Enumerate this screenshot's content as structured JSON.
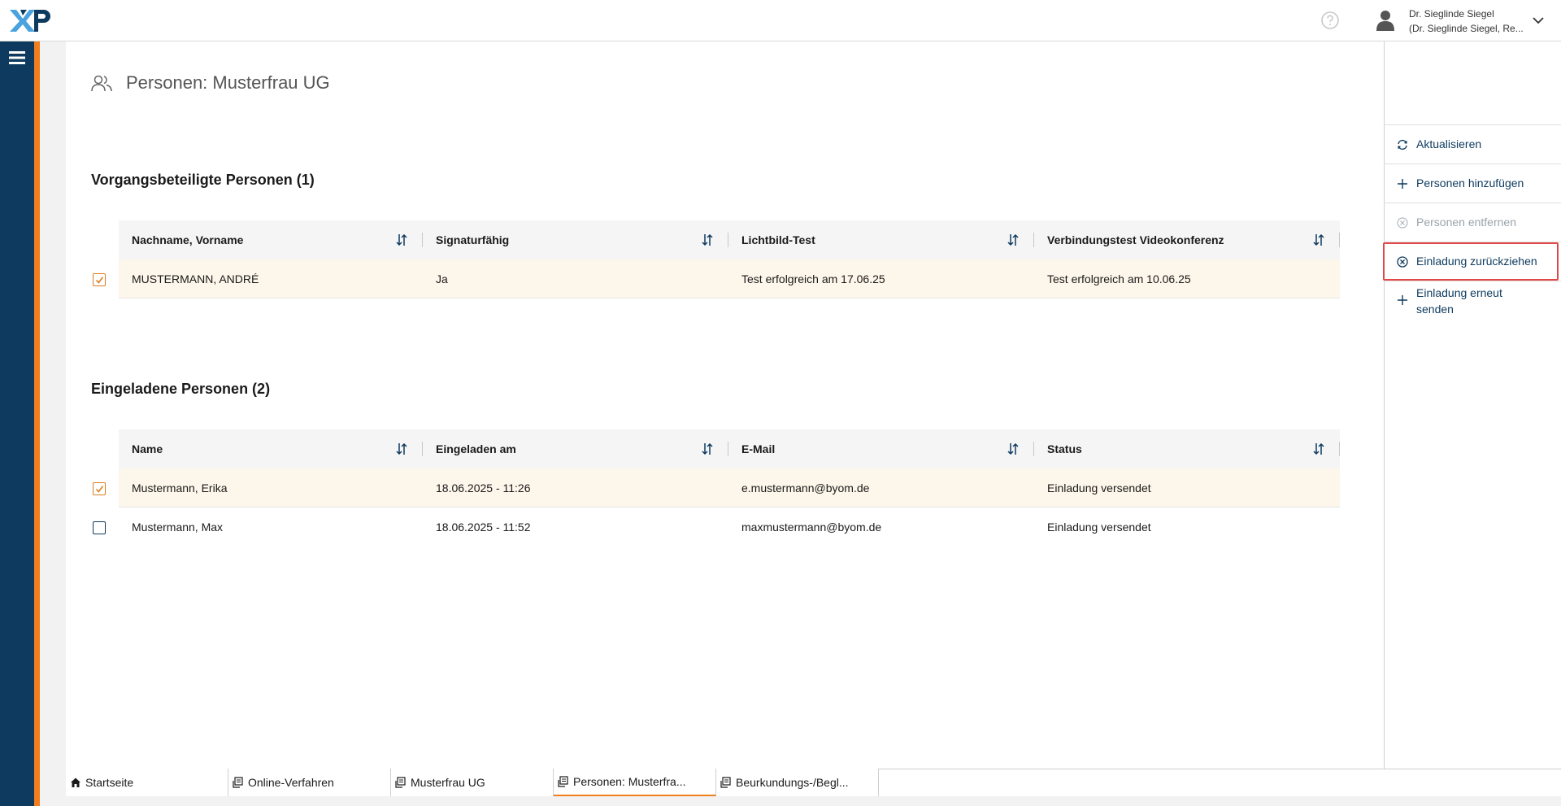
{
  "header": {
    "logo_text": "XNP",
    "help_icon": "question-circle-icon",
    "user": {
      "name": "Dr. Sieglinde Siegel",
      "role": "(Dr. Sieglinde Siegel, Re..."
    }
  },
  "colors": {
    "rail": "#0d3a5e",
    "accent": "#f07e1f",
    "link": "#0d3a5e",
    "highlight": "#e04848",
    "selected_row": "#fdf6ea"
  },
  "page": {
    "title": "Personen: Musterfrau UG"
  },
  "section1": {
    "title": "Vorgangsbeteiligte Personen (1)",
    "columns": [
      "Nachname, Vorname",
      "Signaturfähig",
      "Lichtbild-Test",
      "Verbindungstest Videokonferenz"
    ],
    "rows": [
      {
        "checked": true,
        "cells": [
          "MUSTERMANN, ANDRÉ",
          "Ja",
          "Test erfolgreich am 17.06.25",
          "Test erfolgreich am 10.06.25"
        ]
      }
    ]
  },
  "section2": {
    "title": "Eingeladene Personen (2)",
    "columns": [
      "Name",
      "Eingeladen am",
      "E-Mail",
      "Status"
    ],
    "rows": [
      {
        "checked": true,
        "cells": [
          "Mustermann, Erika",
          "18.06.2025 - 11:26",
          "e.mustermann@byom.de",
          "Einladung versendet"
        ]
      },
      {
        "checked": false,
        "cells": [
          "Mustermann, Max",
          "18.06.2025 - 11:52",
          "maxmustermann@byom.de",
          "Einladung versendet"
        ]
      }
    ]
  },
  "actions": {
    "refresh": "Aktualisieren",
    "add": "Personen hinzufügen",
    "remove": "Personen entfernen",
    "withdraw": "Einladung zurückziehen",
    "resend_line1": "Einladung erneut",
    "resend_line2": "senden"
  },
  "tabs": [
    {
      "label": "Startseite",
      "icon": "home-icon"
    },
    {
      "label": "Online-Verfahren",
      "icon": "document-icon"
    },
    {
      "label": "Musterfrau UG",
      "icon": "document-icon"
    },
    {
      "label": "Personen: Musterfra...",
      "icon": "document-icon",
      "active": true
    },
    {
      "label": "Beurkundungs-/Begl...",
      "icon": "document-icon"
    }
  ]
}
